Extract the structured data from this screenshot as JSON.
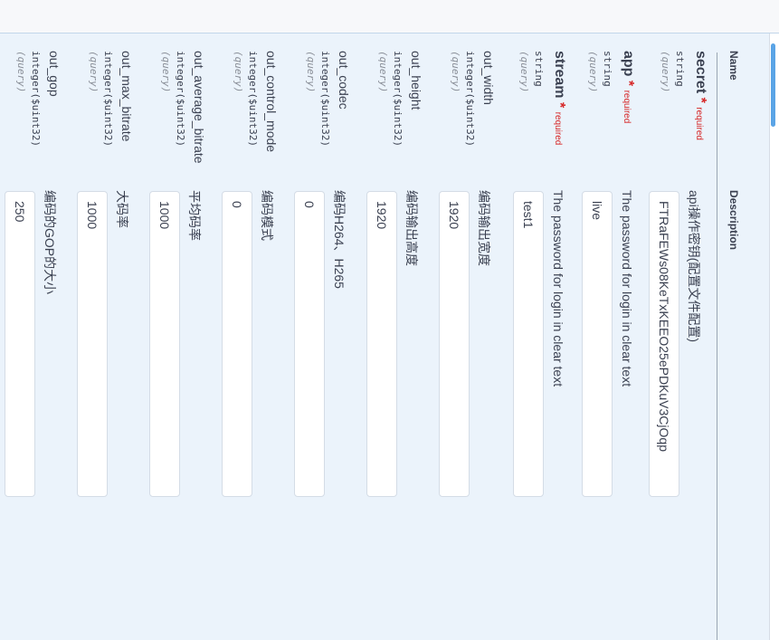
{
  "headers": {
    "name": "Name",
    "description": "Description"
  },
  "params": [
    {
      "name": "secret",
      "required": true,
      "required_label": "required",
      "type": "string",
      "in": "(query)",
      "description": "api操作密钥(配置文件配置)",
      "value": "FTRaFEWs08KeTxKEEO25ePDKuV3CjOqp"
    },
    {
      "name": "app",
      "required": true,
      "required_label": "required",
      "type": "string",
      "in": "(query)",
      "description": "The password for login in clear text",
      "value": "live"
    },
    {
      "name": "stream",
      "required": true,
      "required_label": "required",
      "type": "string",
      "in": "(query)",
      "description": "The password for login in clear text",
      "value": "test1"
    },
    {
      "name": "out_width",
      "required": false,
      "type": "integer($uint32)",
      "in": "(query)",
      "description": "编码输出宽度",
      "value": "1920"
    },
    {
      "name": "out_height",
      "required": false,
      "type": "integer($uint32)",
      "in": "(query)",
      "description": "编码输出高度",
      "value": "1920"
    },
    {
      "name": "out_codec",
      "required": false,
      "type": "integer($uint32)",
      "in": "(query)",
      "description": "编码H264、H265",
      "value": "0"
    },
    {
      "name": "out_control_mode",
      "required": false,
      "type": "integer($uint32)",
      "in": "(query)",
      "description": "编码模式",
      "value": "0"
    },
    {
      "name": "out_average_bitrate",
      "required": false,
      "type": "integer($uint32)",
      "in": "(query)",
      "description": "平均码率",
      "value": "1000"
    },
    {
      "name": "out_max_bitrate",
      "required": false,
      "type": "integer($uint32)",
      "in": "(query)",
      "description": "大码率",
      "value": "1000"
    },
    {
      "name": "out_gop",
      "required": false,
      "type": "integer($uint32)",
      "in": "(query)",
      "description": "编码的GOP的大小",
      "value": "250"
    }
  ]
}
